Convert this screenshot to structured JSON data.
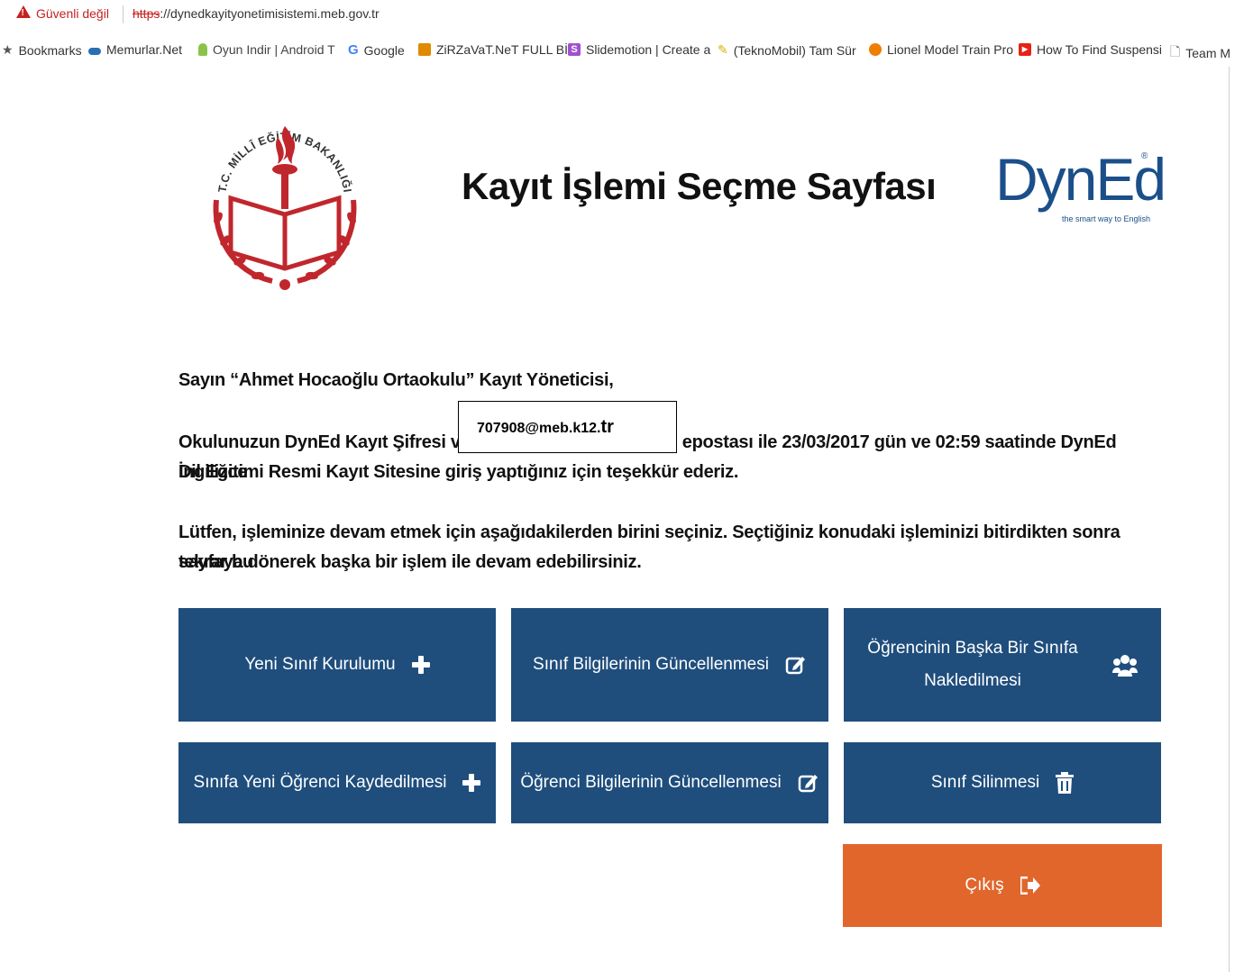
{
  "browser": {
    "security_label": "Güvenli değil",
    "url_scheme": "https",
    "url_rest": "://dynedkayityonetimisistemi.meb.gov.tr"
  },
  "bookmarks": [
    {
      "label": "Bookmarks",
      "icon": "star-icon"
    },
    {
      "label": "Memurlar.Net",
      "icon": "site-icon"
    },
    {
      "label": "Oyun Indir | Android T",
      "icon": "android-icon"
    },
    {
      "label": "Google",
      "icon": "google-icon"
    },
    {
      "label": "ZiRZaVaT.NeT FULL Bİ",
      "icon": "film-icon"
    },
    {
      "label": "Slidemotion | Create a",
      "icon": "slidemotion-icon"
    },
    {
      "label": "(TeknoMobil) Tam Sür",
      "icon": "pencil-icon"
    },
    {
      "label": "Lionel Model Train Pro",
      "icon": "site-icon"
    },
    {
      "label": "How To Find Suspensi",
      "icon": "youtube-icon"
    },
    {
      "label": "Team M",
      "icon": "page-icon"
    }
  ],
  "header": {
    "title": "Kayıt İşlemi Seçme Sayfası",
    "meb_logo_text": "T.C. MİLLÎ EĞİTİM BAKANLIĞI",
    "dyned_logo": "DynEd",
    "dyned_reg": "®",
    "dyned_tagline": "the smart way to English"
  },
  "greeting": "Sayın “Ahmet Hocaoğlu Ortaokulu” Kayıt Yöneticisi,",
  "message": {
    "line1_start": "Okulunuzun DynEd Kayıt Şifresi ve ",
    "line1_end": "epostası ile 23/03/2017 gün ve 02:59 saatinde DynEd İngilizce",
    "line2": "Dil Eğitimi Resmi Kayıt Sitesine giriş yaptığınız için teşekkür ederiz.",
    "email_main": "707908@meb.k12.",
    "email_tld": "tr"
  },
  "instructions": {
    "line1": "Lütfen, işleminize devam etmek için aşağıdakilerden birini seçiniz. Seçtiğiniz konudaki işleminizi bitirdikten sonra tekrar bu",
    "line2": "sayfaya dönerek başka bir işlem ile devam edebilirsiniz."
  },
  "actions": {
    "new_class": "Yeni Sınıf Kurulumu",
    "update_class": "Sınıf Bilgilerinin Güncellenmesi",
    "transfer_line1": "Öğrencinin Başka Bir Sınıfa",
    "transfer_line2": "Nakledilmesi",
    "new_student": "Sınıfa Yeni Öğrenci Kaydedilmesi",
    "update_student": "Öğrenci Bilgilerinin Güncellenmesi",
    "delete_class": "Sınıf Silinmesi",
    "logout": "Çıkış"
  },
  "colors": {
    "button_blue": "#1f4e7d",
    "button_orange": "#e1662c",
    "dyned_blue": "#1b4f8a",
    "meb_red": "#c0272d"
  }
}
